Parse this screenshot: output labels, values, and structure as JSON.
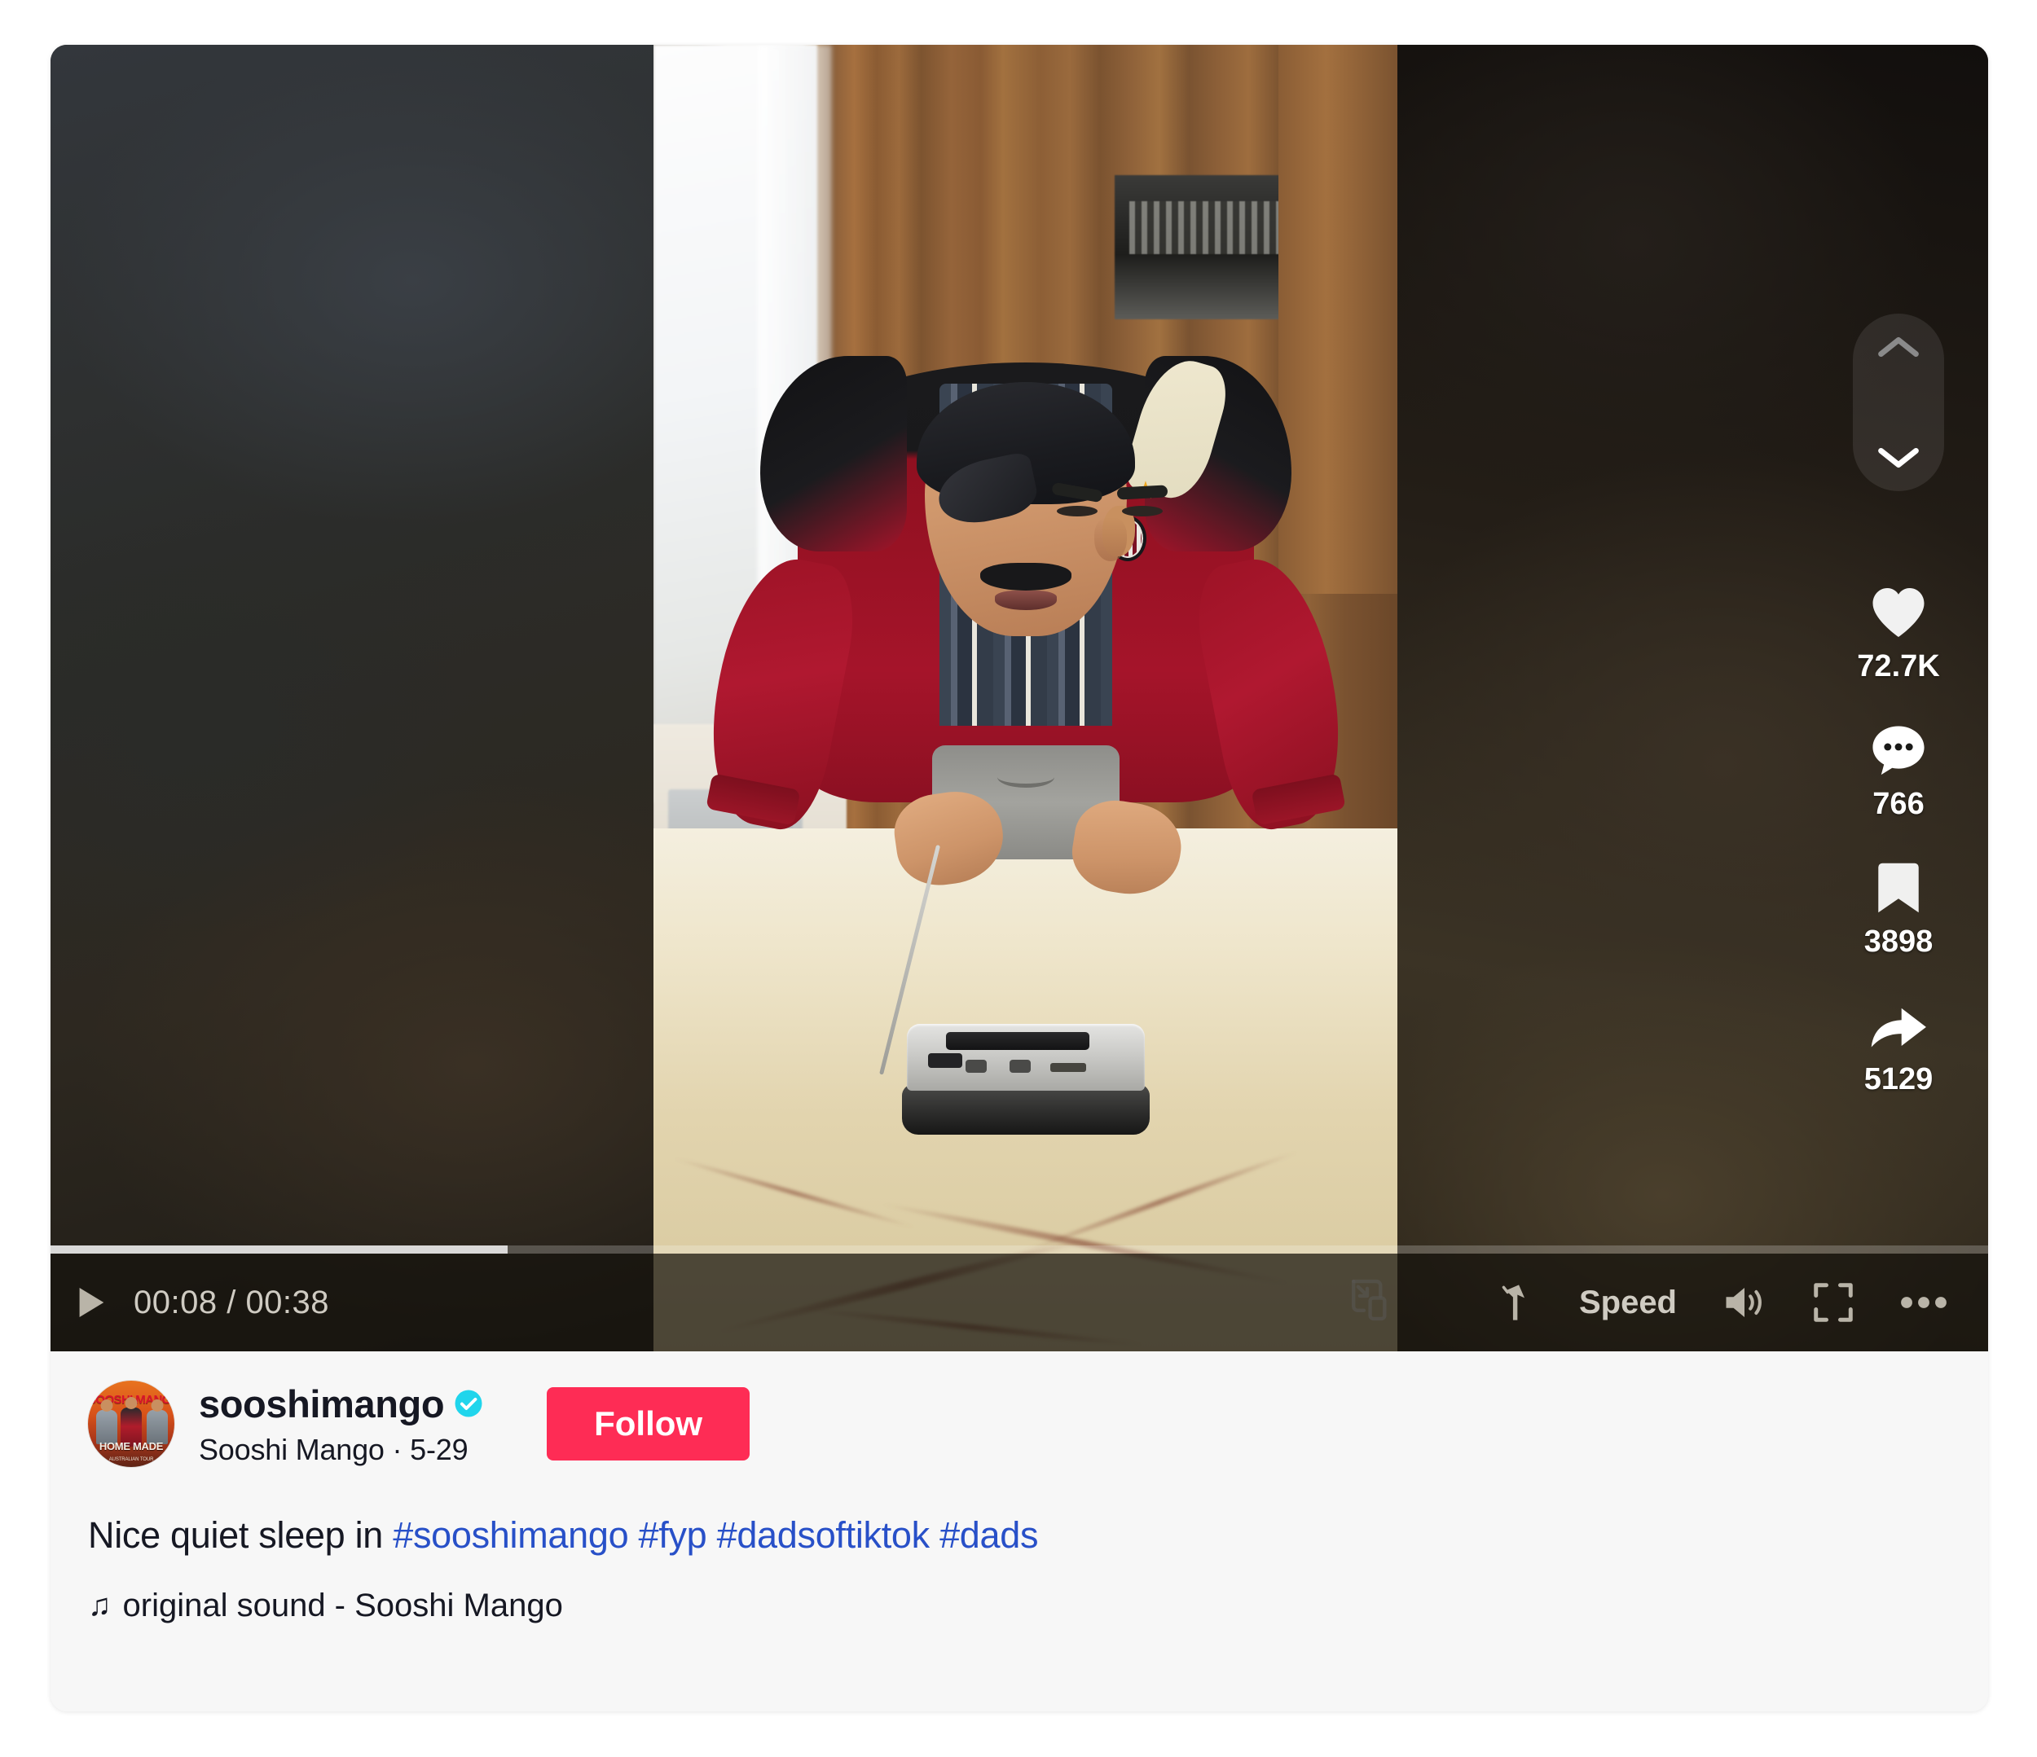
{
  "player": {
    "time_current": "00:08",
    "time_total": "00:38",
    "time_display": "00:08 / 00:38",
    "progress_percent": 23.6,
    "play_icon": "play-icon",
    "pip_icon": "picture-in-picture-icon",
    "clarity_icon": "clarity-tune-icon",
    "speed_label": "Speed",
    "volume_icon": "volume-on-icon",
    "fullscreen_icon": "fullscreen-icon",
    "more_icon": "more-options-icon"
  },
  "rail": {
    "nav_up_icon": "chevron-up-icon",
    "nav_down_icon": "chevron-down-icon",
    "actions": [
      {
        "name": "like",
        "icon": "heart-icon",
        "count": "72.7K"
      },
      {
        "name": "comment",
        "icon": "comment-bubble-icon",
        "count": "766"
      },
      {
        "name": "bookmark",
        "icon": "bookmark-icon",
        "count": "3898"
      },
      {
        "name": "share",
        "icon": "share-arrow-icon",
        "count": "5129"
      }
    ]
  },
  "author": {
    "username": "sooshimango",
    "display_name_and_date": "Sooshi Mango · 5-29",
    "verified": true,
    "verified_icon": "verified-check-icon",
    "avatar_title": "SOOSHI MANGO",
    "avatar_made": "HOME MADE",
    "avatar_sub": "AUSTRALIAN TOUR",
    "follow_label": "Follow"
  },
  "post": {
    "caption_text": "Nice quiet sleep in ",
    "hashtags": [
      "#sooshimango",
      "#fyp",
      "#dadsoftiktok",
      "#dads"
    ],
    "sound_note_glyph": "♫",
    "sound_label": "original sound - Sooshi Mango"
  },
  "colors": {
    "brand_pink": "#fe2c55",
    "hashtag_blue": "#2850c8",
    "text_dark": "#161823",
    "panel_bg": "#f7f7f7",
    "verified_blue": "#20d5ec"
  }
}
